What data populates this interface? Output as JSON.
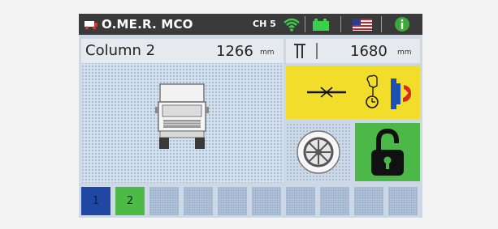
{
  "status_bar": {
    "brand": "O.ME.R. MCO",
    "channel": "CH 5",
    "icons": [
      "truck-logo-icon",
      "wifi-icon",
      "battery-icon",
      "us-flag-icon",
      "info-icon"
    ]
  },
  "column_panel": {
    "label": "Column 2",
    "value": "1266",
    "unit": "mm"
  },
  "height_panel": {
    "value": "1680",
    "unit": "mm",
    "icon": "height-icon"
  },
  "alert_panel": {
    "icons": [
      "lift-position-icon",
      "timer-hand-icon",
      "column-exit-icon"
    ]
  },
  "buttons": {
    "wheel": "wheel-icon",
    "lock": "padlock-open-icon"
  },
  "channel_selector": {
    "items": [
      {
        "label": "1",
        "state": "selected"
      },
      {
        "label": "2",
        "state": "active"
      },
      {
        "label": "",
        "state": "empty"
      },
      {
        "label": "",
        "state": "empty"
      },
      {
        "label": "",
        "state": "empty"
      },
      {
        "label": "",
        "state": "empty"
      },
      {
        "label": "",
        "state": "empty"
      },
      {
        "label": "",
        "state": "empty"
      },
      {
        "label": "",
        "state": "empty"
      },
      {
        "label": "",
        "state": "empty"
      }
    ]
  },
  "colors": {
    "status_bar": "#3a3a3a",
    "alert": "#f2de2a",
    "lock": "#4cb847",
    "selected_channel": "#1f47a3",
    "active_channel": "#4cbb45",
    "wifi": "#3ccf4a",
    "info": "#3ca83a"
  }
}
